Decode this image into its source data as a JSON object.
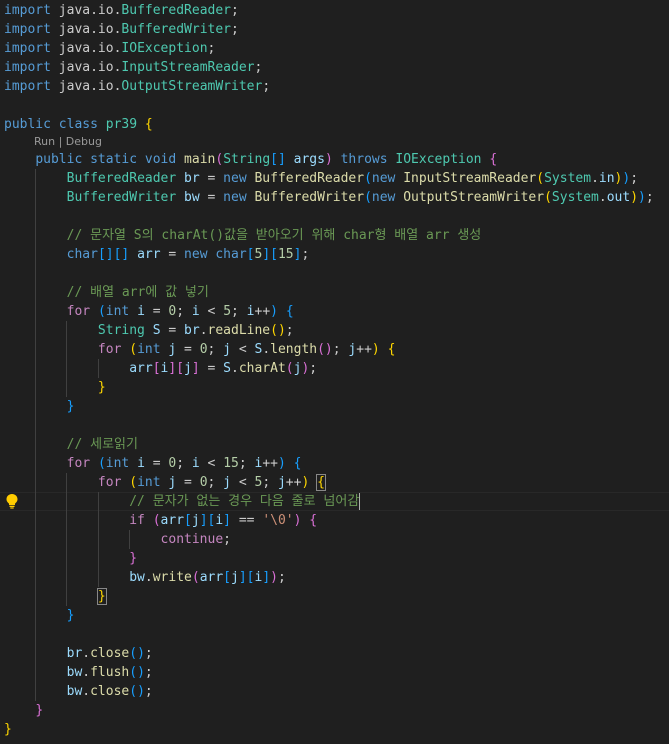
{
  "colors": {
    "background": "#1f1f1f",
    "plain": "#cccccc",
    "keyword": "#569cd6",
    "control": "#c586c0",
    "type": "#4ec9b0",
    "function": "#dcdcaa",
    "variable": "#9cdcfe",
    "number": "#b5cea8",
    "string": "#ce9178",
    "comment": "#6a9955",
    "bracket_gold": "#ffd700",
    "bracket_pink": "#da70d6",
    "bracket_blue": "#179fff",
    "lightbulb": "#ffcc00"
  },
  "code_lens": {
    "run": "Run",
    "separator": " | ",
    "debug": "Debug"
  },
  "lightbulb_icon": "lightbulb-icon",
  "lines": [
    [
      [
        "keyword",
        "import"
      ],
      [
        "plain",
        " java.io."
      ],
      [
        "type",
        "BufferedReader"
      ],
      [
        "plain",
        ";"
      ]
    ],
    [
      [
        "keyword",
        "import"
      ],
      [
        "plain",
        " java.io."
      ],
      [
        "type",
        "BufferedWriter"
      ],
      [
        "plain",
        ";"
      ]
    ],
    [
      [
        "keyword",
        "import"
      ],
      [
        "plain",
        " java.io."
      ],
      [
        "type",
        "IOException"
      ],
      [
        "plain",
        ";"
      ]
    ],
    [
      [
        "keyword",
        "import"
      ],
      [
        "plain",
        " java.io."
      ],
      [
        "type",
        "InputStreamReader"
      ],
      [
        "plain",
        ";"
      ]
    ],
    [
      [
        "keyword",
        "import"
      ],
      [
        "plain",
        " java.io."
      ],
      [
        "type",
        "OutputStreamWriter"
      ],
      [
        "plain",
        ";"
      ]
    ],
    [],
    [
      [
        "keyword",
        "public"
      ],
      [
        "plain",
        " "
      ],
      [
        "keyword",
        "class"
      ],
      [
        "plain",
        " "
      ],
      [
        "type",
        "pr39"
      ],
      [
        "plain",
        " "
      ],
      [
        "bracket_gold",
        "{"
      ]
    ],
    [
      [
        "plain",
        "    "
      ],
      [
        "keyword",
        "public"
      ],
      [
        "plain",
        " "
      ],
      [
        "keyword",
        "static"
      ],
      [
        "plain",
        " "
      ],
      [
        "keyword",
        "void"
      ],
      [
        "plain",
        " "
      ],
      [
        "function",
        "main"
      ],
      [
        "bracket_pink",
        "("
      ],
      [
        "type",
        "String"
      ],
      [
        "bracket_blue",
        "[]"
      ],
      [
        "plain",
        " "
      ],
      [
        "variable",
        "args"
      ],
      [
        "bracket_pink",
        ")"
      ],
      [
        "plain",
        " "
      ],
      [
        "keyword",
        "throws"
      ],
      [
        "plain",
        " "
      ],
      [
        "type",
        "IOException"
      ],
      [
        "plain",
        " "
      ],
      [
        "bracket_pink",
        "{"
      ]
    ],
    [
      [
        "plain",
        "        "
      ],
      [
        "type",
        "BufferedReader"
      ],
      [
        "plain",
        " "
      ],
      [
        "variable",
        "br"
      ],
      [
        "plain",
        " = "
      ],
      [
        "keyword",
        "new"
      ],
      [
        "plain",
        " "
      ],
      [
        "function",
        "BufferedReader"
      ],
      [
        "bracket_blue",
        "("
      ],
      [
        "keyword",
        "new"
      ],
      [
        "plain",
        " "
      ],
      [
        "function",
        "InputStreamReader"
      ],
      [
        "bracket_gold",
        "("
      ],
      [
        "type",
        "System"
      ],
      [
        "plain",
        "."
      ],
      [
        "variable",
        "in"
      ],
      [
        "bracket_gold",
        ")"
      ],
      [
        "bracket_blue",
        ")"
      ],
      [
        "plain",
        ";"
      ]
    ],
    [
      [
        "plain",
        "        "
      ],
      [
        "type",
        "BufferedWriter"
      ],
      [
        "plain",
        " "
      ],
      [
        "variable",
        "bw"
      ],
      [
        "plain",
        " = "
      ],
      [
        "keyword",
        "new"
      ],
      [
        "plain",
        " "
      ],
      [
        "function",
        "BufferedWriter"
      ],
      [
        "bracket_blue",
        "("
      ],
      [
        "keyword",
        "new"
      ],
      [
        "plain",
        " "
      ],
      [
        "function",
        "OutputStreamWriter"
      ],
      [
        "bracket_gold",
        "("
      ],
      [
        "type",
        "System"
      ],
      [
        "plain",
        "."
      ],
      [
        "variable",
        "out"
      ],
      [
        "bracket_gold",
        ")"
      ],
      [
        "bracket_blue",
        ")"
      ],
      [
        "plain",
        ";"
      ]
    ],
    [],
    [
      [
        "plain",
        "        "
      ],
      [
        "comment",
        "// 문자열 S의 charAt()값을 받아오기 위해 char형 배열 arr 생성"
      ]
    ],
    [
      [
        "plain",
        "        "
      ],
      [
        "keyword",
        "char"
      ],
      [
        "bracket_blue",
        "[][]"
      ],
      [
        "plain",
        " "
      ],
      [
        "variable",
        "arr"
      ],
      [
        "plain",
        " = "
      ],
      [
        "keyword",
        "new"
      ],
      [
        "plain",
        " "
      ],
      [
        "keyword",
        "char"
      ],
      [
        "bracket_blue",
        "["
      ],
      [
        "number",
        "5"
      ],
      [
        "bracket_blue",
        "]["
      ],
      [
        "number",
        "15"
      ],
      [
        "bracket_blue",
        "]"
      ],
      [
        "plain",
        ";"
      ]
    ],
    [],
    [
      [
        "plain",
        "        "
      ],
      [
        "comment",
        "// 배열 arr에 값 넣기"
      ]
    ],
    [
      [
        "plain",
        "        "
      ],
      [
        "control",
        "for"
      ],
      [
        "plain",
        " "
      ],
      [
        "bracket_blue",
        "("
      ],
      [
        "keyword",
        "int"
      ],
      [
        "plain",
        " "
      ],
      [
        "variable",
        "i"
      ],
      [
        "plain",
        " = "
      ],
      [
        "number",
        "0"
      ],
      [
        "plain",
        "; "
      ],
      [
        "variable",
        "i"
      ],
      [
        "plain",
        " < "
      ],
      [
        "number",
        "5"
      ],
      [
        "plain",
        "; "
      ],
      [
        "variable",
        "i"
      ],
      [
        "plain",
        "++"
      ],
      [
        "bracket_blue",
        ")"
      ],
      [
        "plain",
        " "
      ],
      [
        "bracket_blue",
        "{"
      ]
    ],
    [
      [
        "plain",
        "            "
      ],
      [
        "type",
        "String"
      ],
      [
        "plain",
        " "
      ],
      [
        "variable",
        "S"
      ],
      [
        "plain",
        " = "
      ],
      [
        "variable",
        "br"
      ],
      [
        "plain",
        "."
      ],
      [
        "function",
        "readLine"
      ],
      [
        "bracket_gold",
        "()"
      ],
      [
        "plain",
        ";"
      ]
    ],
    [
      [
        "plain",
        "            "
      ],
      [
        "control",
        "for"
      ],
      [
        "plain",
        " "
      ],
      [
        "bracket_gold",
        "("
      ],
      [
        "keyword",
        "int"
      ],
      [
        "plain",
        " "
      ],
      [
        "variable",
        "j"
      ],
      [
        "plain",
        " = "
      ],
      [
        "number",
        "0"
      ],
      [
        "plain",
        "; "
      ],
      [
        "variable",
        "j"
      ],
      [
        "plain",
        " < "
      ],
      [
        "variable",
        "S"
      ],
      [
        "plain",
        "."
      ],
      [
        "function",
        "length"
      ],
      [
        "bracket_pink",
        "()"
      ],
      [
        "plain",
        "; "
      ],
      [
        "variable",
        "j"
      ],
      [
        "plain",
        "++"
      ],
      [
        "bracket_gold",
        ")"
      ],
      [
        "plain",
        " "
      ],
      [
        "bracket_gold",
        "{"
      ]
    ],
    [
      [
        "plain",
        "                "
      ],
      [
        "variable",
        "arr"
      ],
      [
        "bracket_pink",
        "["
      ],
      [
        "variable",
        "i"
      ],
      [
        "bracket_pink",
        "]["
      ],
      [
        "variable",
        "j"
      ],
      [
        "bracket_pink",
        "]"
      ],
      [
        "plain",
        " = "
      ],
      [
        "variable",
        "S"
      ],
      [
        "plain",
        "."
      ],
      [
        "function",
        "charAt"
      ],
      [
        "bracket_pink",
        "("
      ],
      [
        "variable",
        "j"
      ],
      [
        "bracket_pink",
        ")"
      ],
      [
        "plain",
        ";"
      ]
    ],
    [
      [
        "plain",
        "            "
      ],
      [
        "bracket_gold",
        "}"
      ]
    ],
    [
      [
        "plain",
        "        "
      ],
      [
        "bracket_blue",
        "}"
      ]
    ],
    [],
    [
      [
        "plain",
        "        "
      ],
      [
        "comment",
        "// 세로읽기"
      ]
    ],
    [
      [
        "plain",
        "        "
      ],
      [
        "control",
        "for"
      ],
      [
        "plain",
        " "
      ],
      [
        "bracket_blue",
        "("
      ],
      [
        "keyword",
        "int"
      ],
      [
        "plain",
        " "
      ],
      [
        "variable",
        "i"
      ],
      [
        "plain",
        " = "
      ],
      [
        "number",
        "0"
      ],
      [
        "plain",
        "; "
      ],
      [
        "variable",
        "i"
      ],
      [
        "plain",
        " < "
      ],
      [
        "number",
        "15"
      ],
      [
        "plain",
        "; "
      ],
      [
        "variable",
        "i"
      ],
      [
        "plain",
        "++"
      ],
      [
        "bracket_blue",
        ")"
      ],
      [
        "plain",
        " "
      ],
      [
        "bracket_blue",
        "{"
      ]
    ],
    [
      [
        "plain",
        "            "
      ],
      [
        "control",
        "for"
      ],
      [
        "plain",
        " "
      ],
      [
        "bracket_gold",
        "("
      ],
      [
        "keyword",
        "int"
      ],
      [
        "plain",
        " "
      ],
      [
        "variable",
        "j"
      ],
      [
        "plain",
        " = "
      ],
      [
        "number",
        "0"
      ],
      [
        "plain",
        "; "
      ],
      [
        "variable",
        "j"
      ],
      [
        "plain",
        " < "
      ],
      [
        "number",
        "5"
      ],
      [
        "plain",
        "; "
      ],
      [
        "variable",
        "j"
      ],
      [
        "plain",
        "++"
      ],
      [
        "bracket_gold",
        ")"
      ],
      [
        "plain",
        " "
      ],
      [
        "bracket_gold_match",
        "{"
      ]
    ],
    [
      [
        "plain",
        "                "
      ],
      [
        "comment",
        "// 문자가 없는 경우 다음 줄로 넘어감"
      ]
    ],
    [
      [
        "plain",
        "                "
      ],
      [
        "control",
        "if"
      ],
      [
        "plain",
        " "
      ],
      [
        "bracket_pink",
        "("
      ],
      [
        "variable",
        "arr"
      ],
      [
        "bracket_blue",
        "["
      ],
      [
        "variable",
        "j"
      ],
      [
        "bracket_blue",
        "]["
      ],
      [
        "variable",
        "i"
      ],
      [
        "bracket_blue",
        "]"
      ],
      [
        "plain",
        " == "
      ],
      [
        "string",
        "'\\0'"
      ],
      [
        "bracket_pink",
        ")"
      ],
      [
        "plain",
        " "
      ],
      [
        "bracket_pink",
        "{"
      ]
    ],
    [
      [
        "plain",
        "                    "
      ],
      [
        "control",
        "continue"
      ],
      [
        "plain",
        ";"
      ]
    ],
    [
      [
        "plain",
        "                "
      ],
      [
        "bracket_pink",
        "}"
      ]
    ],
    [
      [
        "plain",
        "                "
      ],
      [
        "variable",
        "bw"
      ],
      [
        "plain",
        "."
      ],
      [
        "function",
        "write"
      ],
      [
        "bracket_pink",
        "("
      ],
      [
        "variable",
        "arr"
      ],
      [
        "bracket_blue",
        "["
      ],
      [
        "variable",
        "j"
      ],
      [
        "bracket_blue",
        "]["
      ],
      [
        "variable",
        "i"
      ],
      [
        "bracket_blue",
        "]"
      ],
      [
        "bracket_pink",
        ")"
      ],
      [
        "plain",
        ";"
      ]
    ],
    [
      [
        "plain",
        "            "
      ],
      [
        "bracket_gold_match",
        "}"
      ]
    ],
    [
      [
        "plain",
        "        "
      ],
      [
        "bracket_blue",
        "}"
      ]
    ],
    [],
    [
      [
        "plain",
        "        "
      ],
      [
        "variable",
        "br"
      ],
      [
        "plain",
        "."
      ],
      [
        "function",
        "close"
      ],
      [
        "bracket_blue",
        "()"
      ],
      [
        "plain",
        ";"
      ]
    ],
    [
      [
        "plain",
        "        "
      ],
      [
        "variable",
        "bw"
      ],
      [
        "plain",
        "."
      ],
      [
        "function",
        "flush"
      ],
      [
        "bracket_blue",
        "()"
      ],
      [
        "plain",
        ";"
      ]
    ],
    [
      [
        "plain",
        "        "
      ],
      [
        "variable",
        "bw"
      ],
      [
        "plain",
        "."
      ],
      [
        "function",
        "close"
      ],
      [
        "bracket_blue",
        "()"
      ],
      [
        "plain",
        ";"
      ]
    ],
    [
      [
        "plain",
        "    "
      ],
      [
        "bracket_pink",
        "}"
      ]
    ],
    [
      [
        "bracket_gold",
        "}"
      ]
    ]
  ]
}
